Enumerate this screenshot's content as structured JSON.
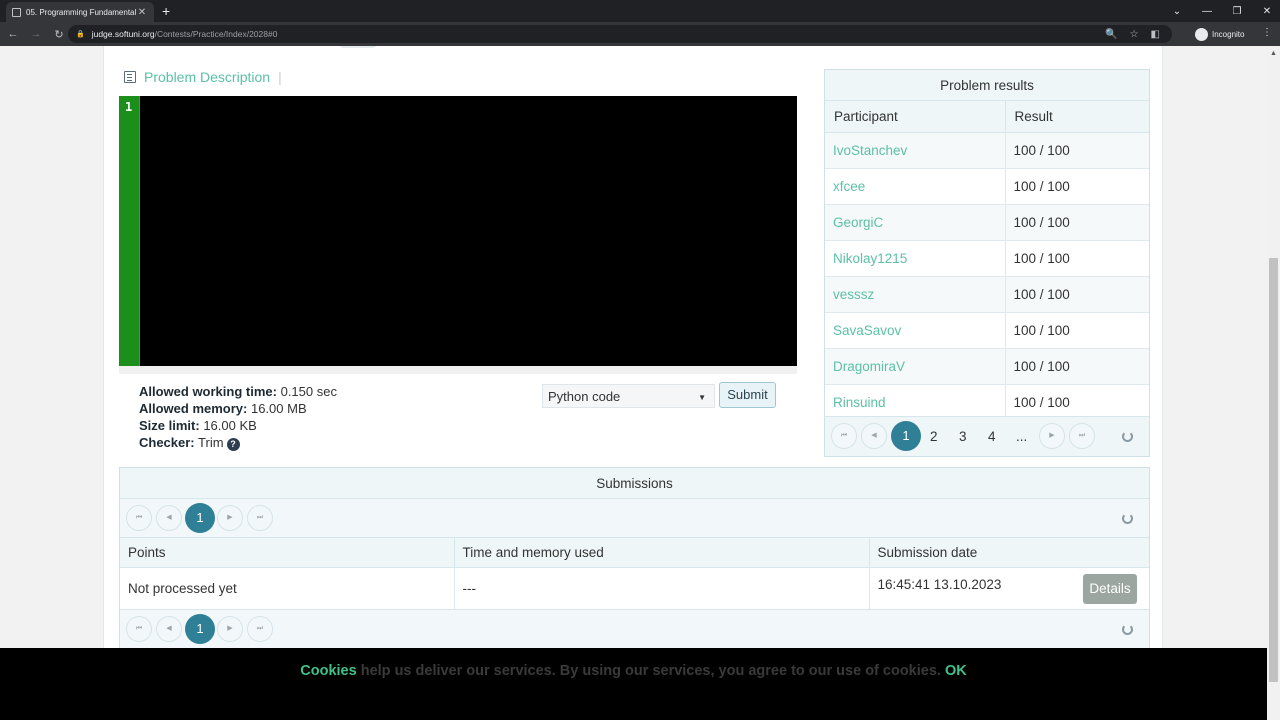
{
  "browser": {
    "tab_title": "05. Programming Fundamentals",
    "tab_close": "✕",
    "new_tab": "+",
    "url_host": "judge.softuni.org",
    "url_path": "/Contests/Practice/Index/2028#0",
    "profile_label": "Incognito",
    "window_controls": [
      "⌄",
      "—",
      "❐",
      "✕"
    ]
  },
  "problem": {
    "description_link": "Problem Description",
    "description_separator": "|",
    "editor_line_number": "1",
    "limits": [
      {
        "label": "Allowed working time:",
        "value": "0.150 sec"
      },
      {
        "label": "Allowed memory:",
        "value": "16.00 MB"
      },
      {
        "label": "Size limit:",
        "value": "16.00 KB"
      },
      {
        "label": "Checker:",
        "value": "Trim"
      }
    ],
    "help_icon": "?",
    "language_selected": "Python code",
    "submit_label": "Submit"
  },
  "results": {
    "title": "Problem results",
    "columns": [
      "Participant",
      "Result"
    ],
    "rows": [
      {
        "participant": "IvoStanchev",
        "result": "100 / 100"
      },
      {
        "participant": "xfcee",
        "result": "100 / 100"
      },
      {
        "participant": "GeorgiC",
        "result": "100 / 100"
      },
      {
        "participant": "Nikolay1215",
        "result": "100 / 100"
      },
      {
        "participant": "vesssz",
        "result": "100 / 100"
      },
      {
        "participant": "SavaSavov",
        "result": "100 / 100"
      },
      {
        "participant": "DragomiraV",
        "result": "100 / 100"
      },
      {
        "participant": "Rinsuind",
        "result": "100 / 100"
      }
    ],
    "pager": {
      "current": "1",
      "pages": [
        "2",
        "3",
        "4"
      ],
      "ellipsis": "..."
    }
  },
  "submissions": {
    "title": "Submissions",
    "pager_current": "1",
    "columns": [
      "Points",
      "Time and memory used",
      "Submission date"
    ],
    "rows": [
      {
        "points": "Not processed yet",
        "time_memory": "---",
        "date": "16:45:41 13.10.2023",
        "details_label": "Details"
      }
    ]
  },
  "cookie_bar": {
    "cookies_word": "Cookies",
    "text": " help us deliver our services. By using our services, you agree to our use of cookies. ",
    "ok_label": "OK"
  },
  "pager_glyphs": {
    "first": "⏮",
    "prev": "◀",
    "next": "▶",
    "last": "⏭"
  },
  "colors": {
    "accent": "#5bc0a5",
    "pager_active": "#2f7f96",
    "editor_gutter": "#1b8e1b",
    "cookie_green": "#41c28a"
  }
}
